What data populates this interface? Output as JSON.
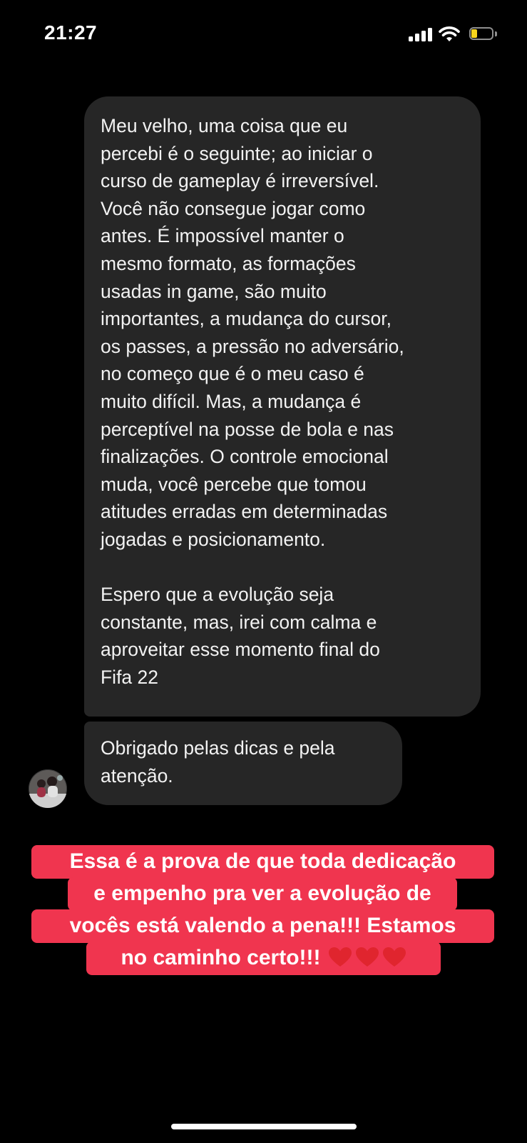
{
  "status_bar": {
    "time": "21:27",
    "battery_color": "#f7d41c"
  },
  "messages": [
    {
      "lines": [
        "Meu velho, uma coisa que eu",
        "percebi é o seguinte; ao iniciar o",
        "curso de gameplay é irreversível.",
        "Você não consegue jogar como",
        "antes. É impossível manter o",
        "mesmo formato, as formações",
        "usadas in game, são muito",
        "importantes, a mudança do cursor,",
        "os passes, a pressão no adversário,",
        "no começo que é o meu caso é",
        "muito difícil. Mas, a mudança é",
        "perceptível na posse de bola e nas",
        "finalizações. O controle emocional",
        "muda, você percebe que tomou",
        "atitudes erradas em determinadas",
        "jogadas e posicionamento.",
        "",
        "Espero que a evolução seja",
        "constante, mas, irei com calma e",
        "aproveitar esse momento final do",
        "Fifa 22"
      ]
    },
    {
      "lines": [
        "Obrigado pelas dicas e pela",
        "atenção."
      ]
    }
  ],
  "caption": {
    "lines": [
      "Essa é a prova de que toda dedicação",
      "e empenho pra ver a evolução de",
      "vocês está valendo a pena!!! Estamos",
      "no caminho certo!!!"
    ],
    "highlight_color": "#f0354f",
    "heart_icon": "heart-icon"
  }
}
